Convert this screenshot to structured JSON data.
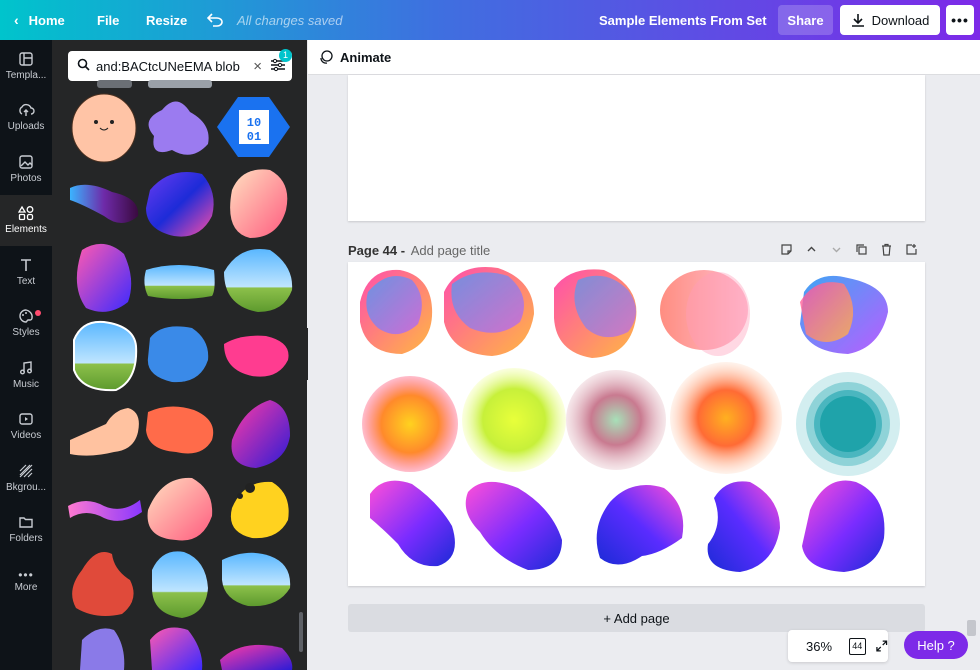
{
  "topbar": {
    "home_label": "Home",
    "file_label": "File",
    "resize_label": "Resize",
    "save_status": "All changes saved",
    "design_title": "Sample Elements From Set",
    "share_label": "Share",
    "download_label": "Download"
  },
  "rail": {
    "items": [
      {
        "label": "Templa...",
        "icon": "template-icon"
      },
      {
        "label": "Uploads",
        "icon": "upload-icon"
      },
      {
        "label": "Photos",
        "icon": "photo-icon"
      },
      {
        "label": "Elements",
        "icon": "elements-icon"
      },
      {
        "label": "Text",
        "icon": "text-icon"
      },
      {
        "label": "Styles",
        "icon": "palette-icon"
      },
      {
        "label": "Music",
        "icon": "music-icon"
      },
      {
        "label": "Videos",
        "icon": "video-icon"
      },
      {
        "label": "Bkgrou...",
        "icon": "background-icon"
      },
      {
        "label": "Folders",
        "icon": "folder-icon"
      },
      {
        "label": "More",
        "icon": "more-icon"
      }
    ]
  },
  "search": {
    "value": "and:BACtcUNeEMA blob",
    "filter_count": "1"
  },
  "animate": {
    "label": "Animate"
  },
  "page": {
    "label": "Page 44 -",
    "title_placeholder": "Add page title"
  },
  "add_page_label": "+ Add page",
  "zoom": {
    "level": "36%",
    "page_count": "44"
  },
  "help_label": "Help ?",
  "colors": {
    "accent": "#7d2ae8",
    "rail": "#0e1318",
    "panel": "#252627"
  }
}
